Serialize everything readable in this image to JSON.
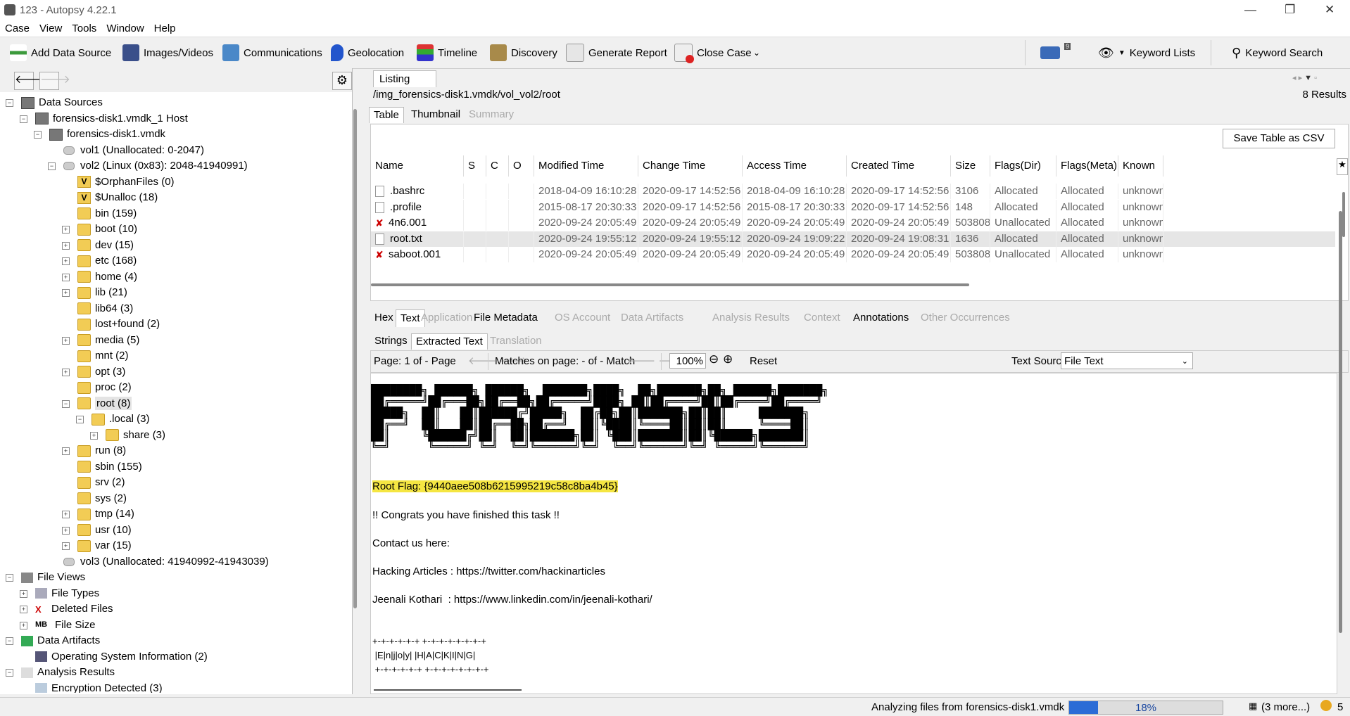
{
  "window": {
    "title": "123 - Autopsy 4.22.1"
  },
  "menu": [
    "Case",
    "View",
    "Tools",
    "Window",
    "Help"
  ],
  "toolbar": {
    "add_data_source": "Add Data Source",
    "images_videos": "Images/Videos",
    "communications": "Communications",
    "geolocation": "Geolocation",
    "timeline": "Timeline",
    "discovery": "Discovery",
    "generate_report": "Generate Report",
    "close_case": "Close Case",
    "mail_count": "9",
    "keyword_lists": "Keyword Lists",
    "keyword_search": "Keyword Search"
  },
  "tree": [
    {
      "label": "Data Sources",
      "indent": 0,
      "icon": "data-sources-icon",
      "exp": "-"
    },
    {
      "label": "forensics-disk1.vmdk_1 Host",
      "indent": 1,
      "icon": "host-icon",
      "exp": "-"
    },
    {
      "label": "forensics-disk1.vmdk",
      "indent": 2,
      "icon": "disk-icon",
      "exp": "-"
    },
    {
      "label": "vol1 (Unallocated: 0-2047)",
      "indent": 3,
      "icon": "volume-icon",
      "exp": ""
    },
    {
      "label": "vol2 (Linux (0x83): 2048-41940991)",
      "indent": 3,
      "icon": "volume-icon",
      "exp": "-"
    },
    {
      "label": "$OrphanFiles (0)",
      "indent": 4,
      "icon": "virtual-folder-icon",
      "exp": ""
    },
    {
      "label": "$Unalloc (18)",
      "indent": 4,
      "icon": "virtual-folder-icon",
      "exp": ""
    },
    {
      "label": "bin (159)",
      "indent": 4,
      "icon": "folder-icon",
      "exp": ""
    },
    {
      "label": "boot (10)",
      "indent": 4,
      "icon": "folder-icon",
      "exp": "+"
    },
    {
      "label": "dev (15)",
      "indent": 4,
      "icon": "folder-icon",
      "exp": "+"
    },
    {
      "label": "etc (168)",
      "indent": 4,
      "icon": "folder-icon",
      "exp": "+"
    },
    {
      "label": "home (4)",
      "indent": 4,
      "icon": "folder-icon",
      "exp": "+"
    },
    {
      "label": "lib (21)",
      "indent": 4,
      "icon": "folder-icon",
      "exp": "+"
    },
    {
      "label": "lib64 (3)",
      "indent": 4,
      "icon": "folder-icon",
      "exp": ""
    },
    {
      "label": "lost+found (2)",
      "indent": 4,
      "icon": "folder-icon",
      "exp": ""
    },
    {
      "label": "media (5)",
      "indent": 4,
      "icon": "folder-icon",
      "exp": "+"
    },
    {
      "label": "mnt (2)",
      "indent": 4,
      "icon": "folder-icon",
      "exp": ""
    },
    {
      "label": "opt (3)",
      "indent": 4,
      "icon": "folder-icon",
      "exp": "+"
    },
    {
      "label": "proc (2)",
      "indent": 4,
      "icon": "folder-icon",
      "exp": ""
    },
    {
      "label": "root (8)",
      "indent": 4,
      "icon": "folder-icon",
      "exp": "-",
      "selected": true
    },
    {
      "label": ".local (3)",
      "indent": 5,
      "icon": "folder-icon",
      "exp": "-"
    },
    {
      "label": "share (3)",
      "indent": 6,
      "icon": "folder-icon",
      "exp": "+"
    },
    {
      "label": "run (8)",
      "indent": 4,
      "icon": "folder-icon",
      "exp": "+"
    },
    {
      "label": "sbin (155)",
      "indent": 4,
      "icon": "folder-icon",
      "exp": ""
    },
    {
      "label": "srv (2)",
      "indent": 4,
      "icon": "folder-icon",
      "exp": ""
    },
    {
      "label": "sys (2)",
      "indent": 4,
      "icon": "folder-icon",
      "exp": ""
    },
    {
      "label": "tmp (14)",
      "indent": 4,
      "icon": "folder-icon",
      "exp": "+"
    },
    {
      "label": "usr (10)",
      "indent": 4,
      "icon": "folder-icon",
      "exp": "+"
    },
    {
      "label": "var (15)",
      "indent": 4,
      "icon": "folder-icon",
      "exp": "+"
    },
    {
      "label": "vol3 (Unallocated: 41940992-41943039)",
      "indent": 3,
      "icon": "volume-icon",
      "exp": ""
    },
    {
      "label": "File Views",
      "indent": 0,
      "icon": "eye-icon",
      "exp": "-"
    },
    {
      "label": "File Types",
      "indent": 1,
      "icon": "file-types-icon",
      "exp": "+"
    },
    {
      "label": "Deleted Files",
      "indent": 1,
      "icon": "deleted-icon",
      "exp": "+"
    },
    {
      "label": "File Size",
      "indent": 1,
      "icon": "mb-icon",
      "exp": "+"
    },
    {
      "label": "Data Artifacts",
      "indent": 0,
      "icon": "artifacts-icon",
      "exp": "-"
    },
    {
      "label": "Operating System Information (2)",
      "indent": 1,
      "icon": "os-icon",
      "exp": ""
    },
    {
      "label": "Analysis Results",
      "indent": 0,
      "icon": "magnifier-icon",
      "exp": "-"
    },
    {
      "label": "Encryption Detected (3)",
      "indent": 1,
      "icon": "encryption-icon",
      "exp": ""
    }
  ],
  "listing": {
    "tab": "Listing",
    "path": "/img_forensics-disk1.vmdk/vol_vol2/root",
    "results": "8  Results",
    "subtabs": [
      "Table",
      "Thumbnail",
      "Summary"
    ],
    "save_csv": "Save Table as CSV",
    "columns": [
      "Name",
      "S",
      "C",
      "O",
      "Modified Time",
      "Change Time",
      "Access Time",
      "Created Time",
      "Size",
      "Flags(Dir)",
      "Flags(Meta)",
      "Known"
    ],
    "rows": [
      {
        "name": ".bashrc",
        "deleted": false,
        "modified": "2018-04-09 16:10:28 PKT",
        "change": "2020-09-17 14:52:56 PKT",
        "access": "2018-04-09 16:10:28 PKT",
        "created": "2020-09-17 14:52:56 PKT",
        "size": "3106",
        "flags_dir": "Allocated",
        "flags_meta": "Allocated",
        "known": "unknown"
      },
      {
        "name": ".profile",
        "deleted": false,
        "modified": "2015-08-17 20:30:33 PKT",
        "change": "2020-09-17 14:52:56 PKT",
        "access": "2015-08-17 20:30:33 PKT",
        "created": "2020-09-17 14:52:56 PKT",
        "size": "148",
        "flags_dir": "Allocated",
        "flags_meta": "Allocated",
        "known": "unknown"
      },
      {
        "name": "4n6.001",
        "deleted": true,
        "modified": "2020-09-24 20:05:49 PKT",
        "change": "2020-09-24 20:05:49 PKT",
        "access": "2020-09-24 20:05:49 PKT",
        "created": "2020-09-24 20:05:49 PKT",
        "size": "503808",
        "flags_dir": "Unallocated",
        "flags_meta": "Allocated",
        "known": "unknown"
      },
      {
        "name": "root.txt",
        "deleted": false,
        "selected": true,
        "modified": "2020-09-24 19:55:12 PKT",
        "change": "2020-09-24 19:55:12 PKT",
        "access": "2020-09-24 19:09:22 PKT",
        "created": "2020-09-24 19:08:31 PKT",
        "size": "1636",
        "flags_dir": "Allocated",
        "flags_meta": "Allocated",
        "known": "unknown"
      },
      {
        "name": "saboot.001",
        "deleted": true,
        "modified": "2020-09-24 20:05:49 PKT",
        "change": "2020-09-24 20:05:49 PKT",
        "access": "2020-09-24 20:05:49 PKT",
        "created": "2020-09-24 20:05:49 PKT",
        "size": "503808",
        "flags_dir": "Unallocated",
        "flags_meta": "Allocated",
        "known": "unknown"
      }
    ]
  },
  "content_tabs": [
    {
      "label": "Hex",
      "enabled": true
    },
    {
      "label": "Text",
      "enabled": true,
      "selected": true
    },
    {
      "label": "Application",
      "enabled": false
    },
    {
      "label": "File Metadata",
      "enabled": true
    },
    {
      "label": "OS Account",
      "enabled": false
    },
    {
      "label": "Data Artifacts",
      "enabled": false
    },
    {
      "label": "Analysis Results",
      "enabled": false
    },
    {
      "label": "Context",
      "enabled": false
    },
    {
      "label": "Annotations",
      "enabled": true
    },
    {
      "label": "Other Occurrences",
      "enabled": false
    }
  ],
  "text_subtabs": [
    {
      "label": "Strings",
      "enabled": true
    },
    {
      "label": "Extracted Text",
      "enabled": true,
      "selected": true
    },
    {
      "label": "Translation",
      "enabled": false
    }
  ],
  "viewer": {
    "page": "Page: 1 of - Page",
    "matches": "Matches on page:  -  of  -  Match",
    "zoom": "100%",
    "reset": "Reset",
    "text_source_label": "Text Source:",
    "text_source_value": "File Text"
  },
  "content": {
    "ascii_art": [
      "████████╗ ██████╗ ██████╗  ███████╗████╗  ██╗███████╗██╗ ██████╗███████╗",
      "██╔═════╝██╔═══██╗██╔══██╗██╔═════╝████╗ ██║██╔════╝██║██╔════╝██╔════╝",
      "█████╗  ██║   ██║██████╔╝█████╗  ██╔██╗██║███████╗██║██║     ███████╗",
      "██╔══╝  ██║   ██║██╔══██╗██╔══╝  ██║╚████║╚════██║██║██║     ╚════██║",
      "██║     ╚██████╔╝██║  ██║███████╗██║ ╚███║███████║██║╚██████╗███████║",
      "╚═╝      ╚═════╝ ╚═╝  ╚═╝╚══════╝╚═╝  ╚══╝╚══════╝╚═╝ ╚═════╝╚══════╝"
    ],
    "flag": "Root Flag: {9440aee508b6215995219c58c8ba4b45}",
    "congrats": "!! Congrats you have finished this task !!",
    "contact": "Contact us here:",
    "hacking": "Hacking Articles : https://twitter.com/hackinarticles",
    "jeenali": "Jeenali Kothari  : https://www.linkedin.com/in/jeenali-kothari/",
    "enjoy_top": "+-+-+-+-+-+ +-+-+-+-+-+-+-+",
    "enjoy_mid": " |E|n|j|o|y| |H|A|C|K|I|N|G|",
    "enjoy_bot": " +-+-+-+-+-+ +-+-+-+-+-+-+-+"
  },
  "status": {
    "analyzing": "Analyzing files from forensics-disk1.vmdk",
    "progress_percent": 18,
    "progress_label": "18%",
    "more": "(3 more...)",
    "notifications": "5"
  }
}
